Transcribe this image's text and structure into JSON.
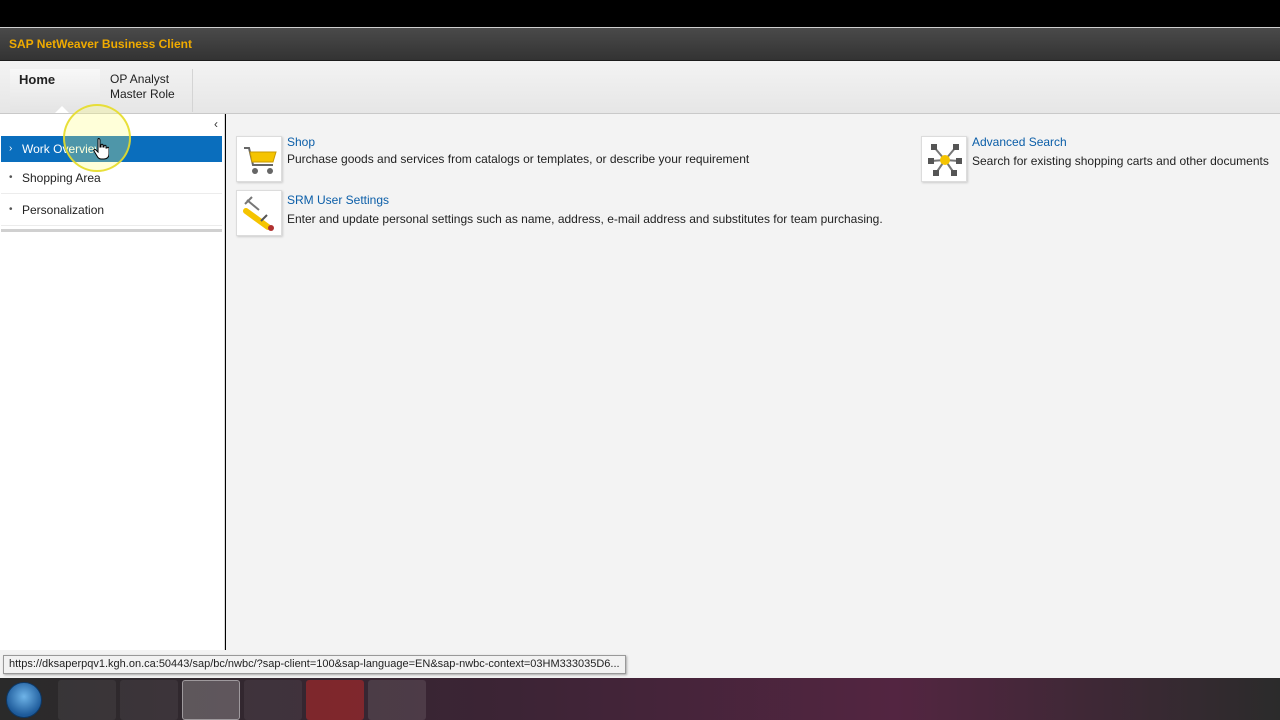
{
  "app": {
    "title": "SAP NetWeaver Business Client"
  },
  "tabs": [
    {
      "label": "Home"
    },
    {
      "label_line1": "OP Analyst",
      "label_line2": "Master Role"
    }
  ],
  "nav": {
    "items": [
      {
        "label": "Work Overview",
        "active": true
      },
      {
        "label": "Shopping Area",
        "active": false
      },
      {
        "label": "Personalization",
        "active": false
      }
    ]
  },
  "tiles": [
    {
      "title": "Shop",
      "description": "Purchase goods and services from catalogs or templates, or describe your requirement",
      "icon": "shopping-cart-icon"
    },
    {
      "title": "Advanced Search",
      "description": "Search for existing shopping carts and other documents",
      "icon": "network-search-icon"
    },
    {
      "title": "SRM User Settings",
      "description": "Enter and update personal settings such as name, address, e-mail address and substitutes for team purchasing.",
      "icon": "settings-tools-icon"
    }
  ],
  "status": {
    "url": "https://dksaperpqv1.kgh.on.ca:50443/sap/bc/nwbc/?sap-client=100&sap-language=EN&sap-nwbc-context=03HM333035D6..."
  },
  "colors": {
    "accent": "#f0ab00",
    "selection": "#0a6ebd",
    "link": "#0b5ea8"
  }
}
